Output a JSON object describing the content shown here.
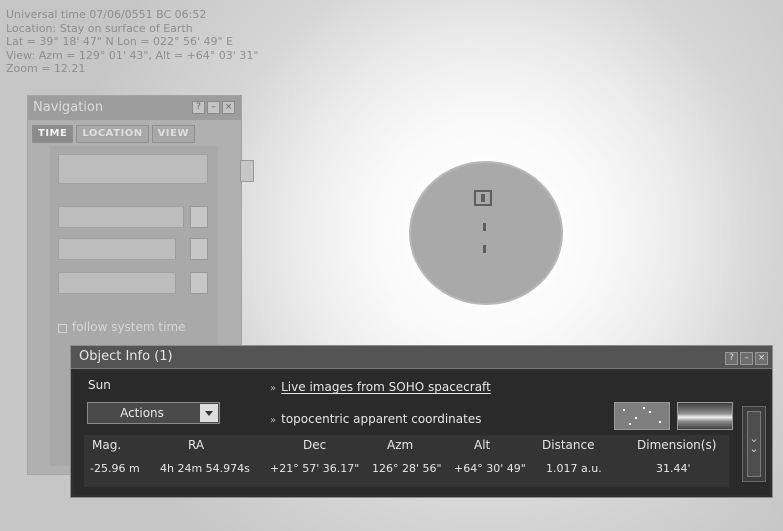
{
  "hud": {
    "line1": "Universal time 07/06/0551 BC 06:52",
    "line2": "Location: Stay on surface of Earth",
    "line3": "Lat = 39° 18' 47\" N  Lon = 022° 56' 49\" E",
    "line4": "View: Azm = 129° 01' 43\", Alt = +64° 03' 31\"",
    "line5": "Zoom = 12.21"
  },
  "navigation": {
    "title": "Navigation",
    "tabs": [
      "TIME",
      "LOCATION",
      "VIEW"
    ],
    "follow_label": "follow system time"
  },
  "object_info": {
    "title": "Object Info (1)",
    "object_name": "Sun",
    "actions_label": "Actions",
    "link1": "Live images from SOHO spacecraft",
    "link2": "topocentric apparent coordinates",
    "headers": [
      "Mag.",
      "RA",
      "Dec",
      "Azm",
      "Alt",
      "Distance",
      "Dimension(s)"
    ],
    "values": [
      "-25.96 m",
      "4h 24m 54.974s",
      "+21° 57' 36.17\"",
      "126° 28' 56\"",
      "+64° 30' 49\"",
      "1.017 a.u.",
      "31.44'"
    ]
  },
  "icons": {
    "window_buttons": [
      "help-icon",
      "minimize-icon",
      "close-icon"
    ],
    "expand": "double-chevron-down-icon"
  }
}
